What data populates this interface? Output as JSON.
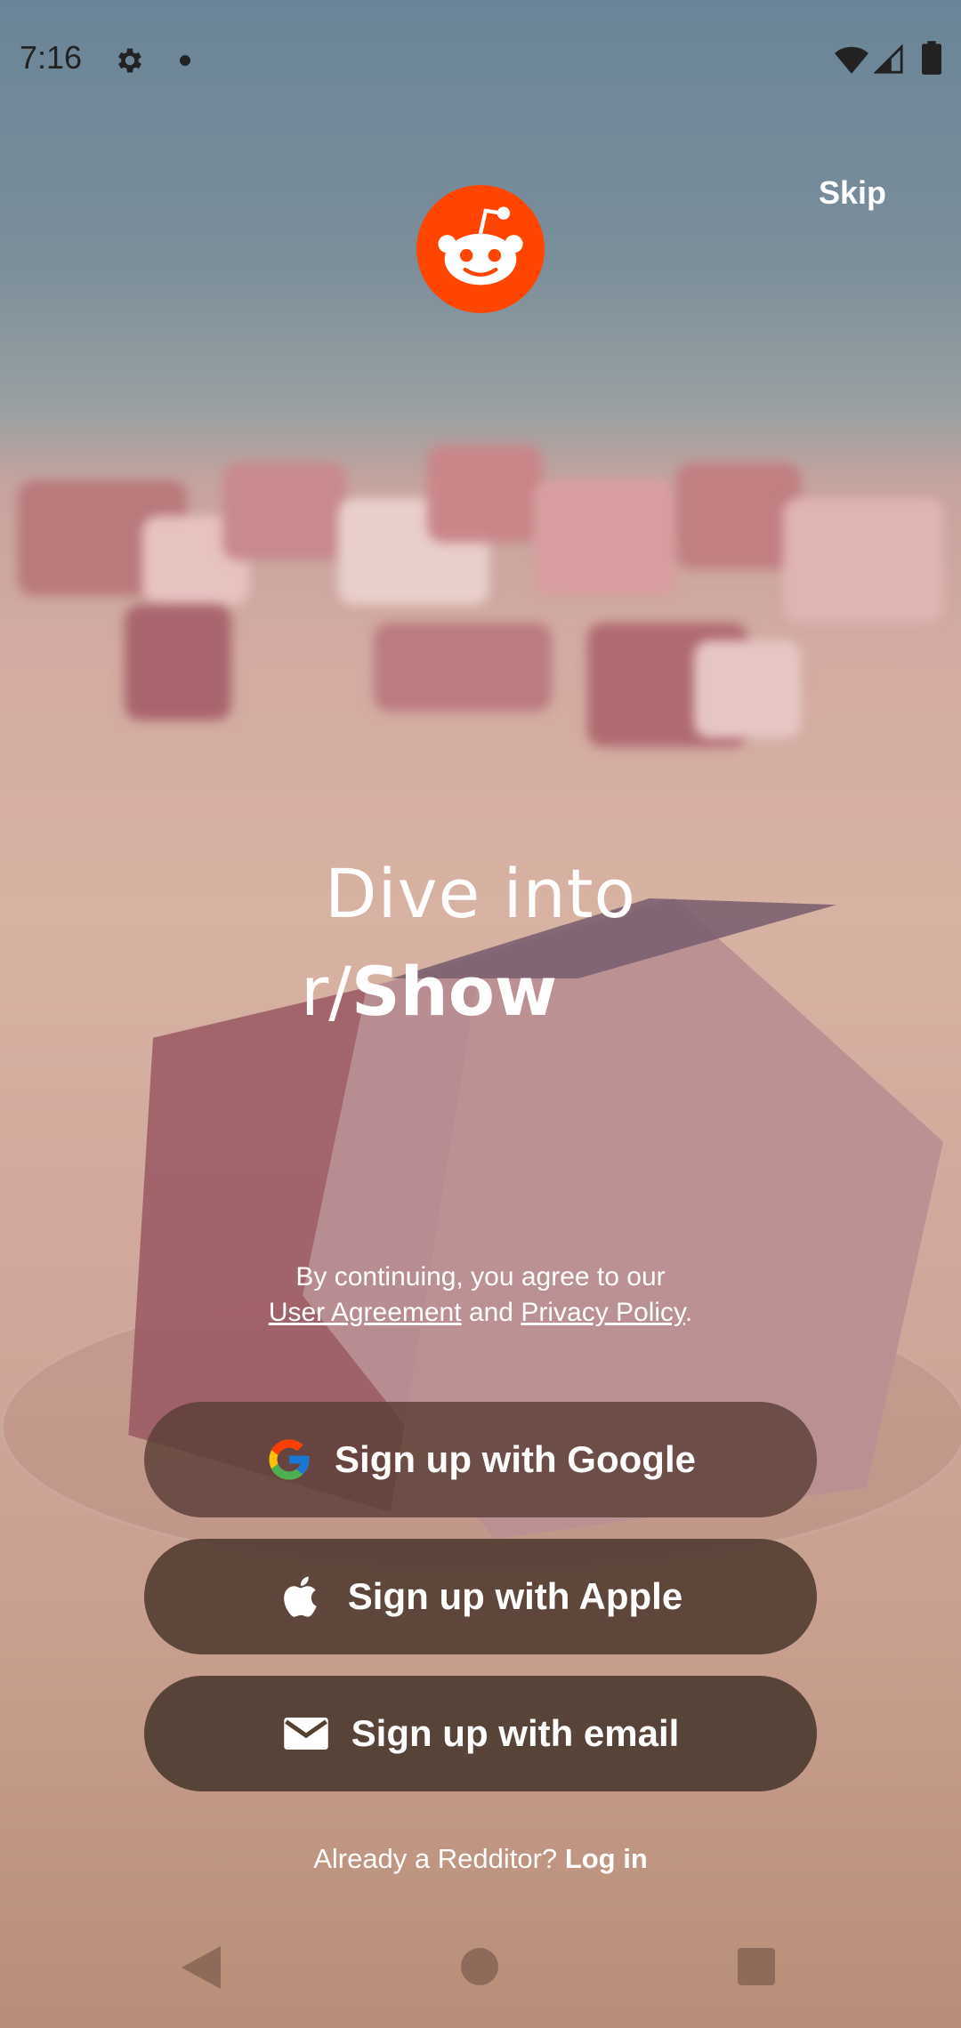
{
  "status_bar": {
    "time": "7:16"
  },
  "skip_label": "Skip",
  "headline": {
    "line1": "Dive into",
    "line2_prefix": "r/",
    "line2_name": "Show"
  },
  "legal": {
    "intro": "By continuing, you agree to our",
    "user_agreement": "User Agreement",
    "and": "and",
    "privacy_policy": "Privacy Policy",
    "period": "."
  },
  "buttons": {
    "google": "Sign up with Google",
    "apple": "Sign up with Apple",
    "email": "Sign up with email"
  },
  "login_prompt": {
    "text": "Already a Redditor?",
    "link": "Log in"
  },
  "colors": {
    "reddit_orange": "#FF4500",
    "button_bg": "#53402f"
  },
  "icons": {
    "status": [
      "gear-icon",
      "notification-dot-icon",
      "wifi-icon",
      "cell-signal-icon",
      "battery-icon"
    ],
    "logo": "reddit-snoo-logo",
    "buttons": [
      "google-icon",
      "apple-icon",
      "email-icon"
    ],
    "nav": [
      "back-icon",
      "home-icon",
      "recents-icon"
    ]
  }
}
